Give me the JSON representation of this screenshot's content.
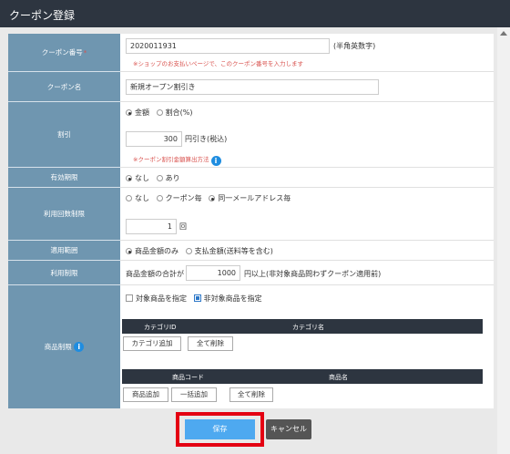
{
  "title": "クーポン登録",
  "fields": {
    "coupon_code": {
      "label": "クーポン番号",
      "required_mark": "*",
      "value": "2020011931",
      "note": "(半角英数字)",
      "error": "※ショップのお支払いページで、このクーポン番号を入力します"
    },
    "coupon_name": {
      "label": "クーポン名",
      "value": "新規オープン割引き"
    },
    "discount": {
      "label": "割引",
      "option_amount": "金額",
      "option_rate": "割合(%)",
      "value": "300",
      "unit": "円引き(税込)",
      "error": "※クーポン割引金額算出方法"
    },
    "expiry": {
      "label": "有効期限",
      "option_none": "なし",
      "option_yes": "あり"
    },
    "usage_limit": {
      "label": "利用回数制限",
      "option_none": "なし",
      "option_per_coupon": "クーポン毎",
      "option_per_email": "同一メールアドレス毎",
      "value": "1",
      "unit": "回"
    },
    "scope": {
      "label": "適用範囲",
      "option_product": "商品金額のみ",
      "option_payment": "支払金額(送料等を含む)"
    },
    "condition": {
      "label": "利用制限",
      "prefix": "商品金額の合計が",
      "value": "1000",
      "suffix": "円以上(非対象商品問わずクーポン適用前)"
    },
    "product_limit": {
      "label": "商品制限",
      "option_target": "対象商品を指定",
      "option_exclude": "非対象商品を指定",
      "category_headers": {
        "id": "カテゴリID",
        "name": "カテゴリ名"
      },
      "category_add": "カテゴリ追加",
      "category_delete_all": "全て削除",
      "product_headers": {
        "code": "商品コード",
        "name": "商品名"
      },
      "product_add": "商品追加",
      "product_bulk_add": "一括追加",
      "product_delete_all": "全て削除"
    }
  },
  "actions": {
    "save": "保存",
    "cancel": "キャンセル"
  }
}
